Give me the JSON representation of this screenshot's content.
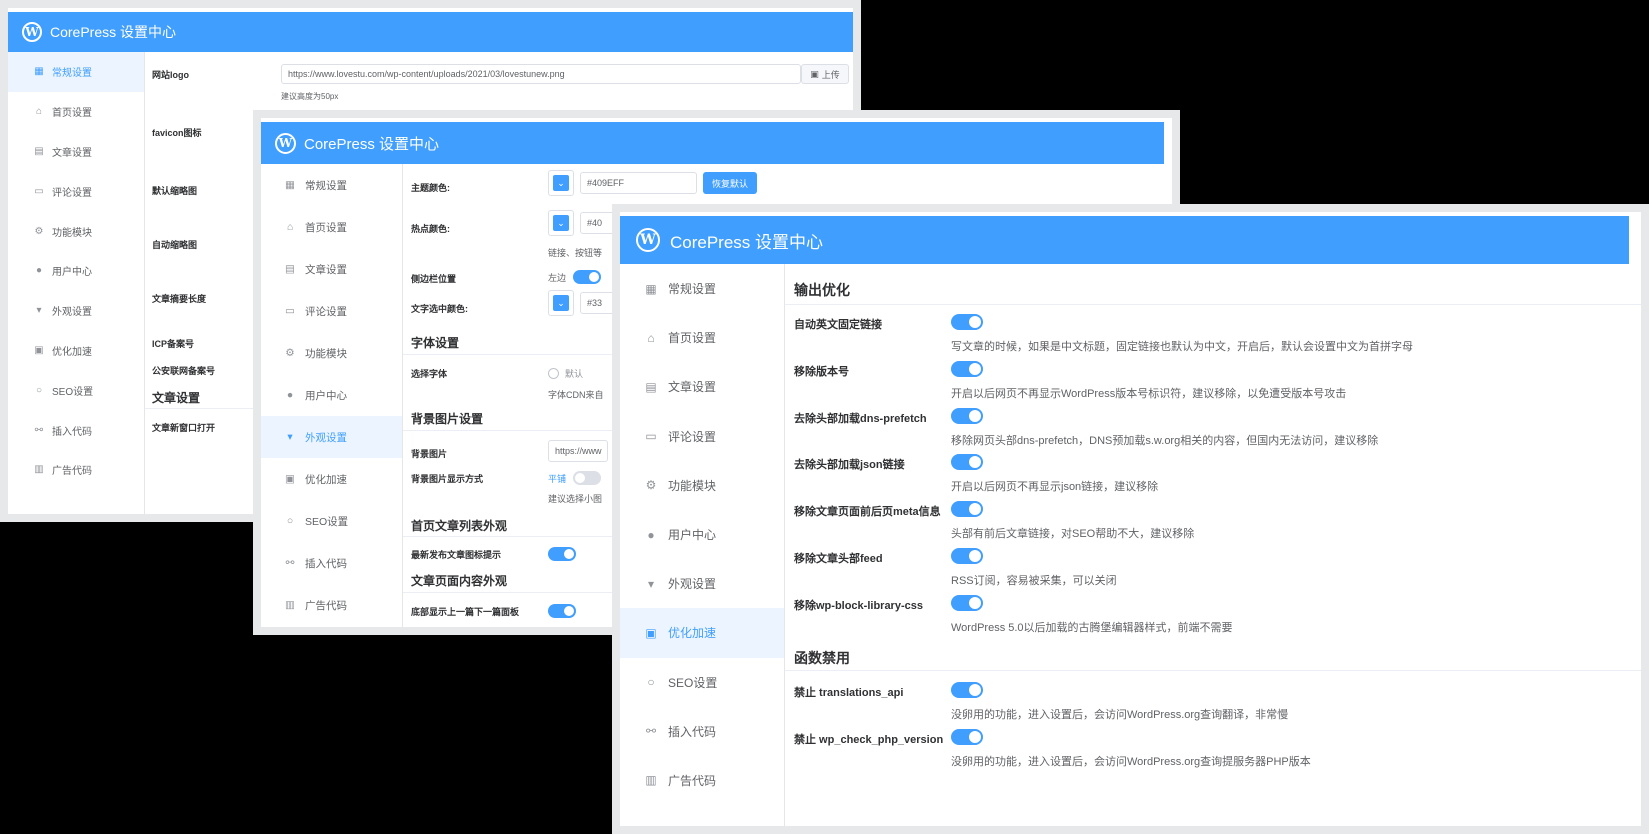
{
  "app_title": "CorePress 设置中心",
  "logo_letter": "W",
  "accent_color": "#409EFF",
  "nav": [
    {
      "label": "常规设置",
      "icon": "grid-icon",
      "glyph": "▦"
    },
    {
      "label": "首页设置",
      "icon": "home-icon",
      "glyph": "⌂"
    },
    {
      "label": "文章设置",
      "icon": "document-icon",
      "glyph": "▤"
    },
    {
      "label": "评论设置",
      "icon": "comment-icon",
      "glyph": "▭"
    },
    {
      "label": "功能模块",
      "icon": "gear-icon",
      "glyph": "⚙"
    },
    {
      "label": "用户中心",
      "icon": "user-icon",
      "glyph": "●"
    },
    {
      "label": "外观设置",
      "icon": "brush-icon",
      "glyph": "▾"
    },
    {
      "label": "优化加速",
      "icon": "chart-icon",
      "glyph": "▣"
    },
    {
      "label": "SEO设置",
      "icon": "search-icon",
      "glyph": "○"
    },
    {
      "label": "插入代码",
      "icon": "link-icon",
      "glyph": "⚯"
    },
    {
      "label": "广告代码",
      "icon": "ad-icon",
      "glyph": "▥"
    }
  ],
  "panel1": {
    "active_nav": 0,
    "logo_label": "网站logo",
    "logo_url": "https://www.lovestu.com/wp-content/uploads/2021/03/lovestunew.png",
    "upload_label": "上传",
    "logo_hint": "建议高度为50px",
    "labels": [
      "favicon图标",
      "默认缩略图",
      "自动缩略图",
      "文章摘要长度",
      "ICP备案号",
      "公安联网备案号"
    ],
    "section_article": "文章设置",
    "new_window_label": "文章新窗口打开"
  },
  "panel2": {
    "active_nav": 6,
    "theme_color_label": "主题颜色:",
    "theme_color_value": "#409EFF",
    "reset_label": "恢复默认",
    "hot_color_label": "热点颜色:",
    "hot_color_value": "#40",
    "hot_hint": "链接、按钮等",
    "sidebar_pos_label": "侧边栏位置",
    "sidebar_pos_value": "左边",
    "select_color_label": "文字选中颜色:",
    "select_color_value": "#33",
    "font_section": "字体设置",
    "font_label": "选择字体",
    "font_default": "默认",
    "font_hint": "字体CDN来自",
    "bg_section": "背景图片设置",
    "bg_label": "背景图片",
    "bg_value": "https://www",
    "bg_mode_label": "背景图片显示方式",
    "bg_mode_value": "平铺",
    "bg_hint": "建议选择小图",
    "home_list_section": "首页文章列表外观",
    "new_post_label": "最新发布文章图标提示",
    "article_section": "文章页面内容外观",
    "cut_label": "底部显示上一篇下一篇面板"
  },
  "panel3": {
    "active_nav": 7,
    "section_output": "输出优化",
    "output_items": [
      {
        "label": "自动英文固定链接",
        "desc": "写文章的时候，如果是中文标题，固定链接也默认为中文，开启后，默认会设置中文为首拼字母"
      },
      {
        "label": "移除版本号",
        "desc": "开启以后网页不再显示WordPress版本号标识符，建议移除，以免遭受版本号攻击"
      },
      {
        "label": "去除头部加载dns-prefetch",
        "desc": "移除网页头部dns-prefetch，DNS预加载s.w.org相关的内容，但国内无法访问，建议移除"
      },
      {
        "label": "去除头部加载json链接",
        "desc": "开启以后网页不再显示json链接，建议移除"
      },
      {
        "label": "移除文章页面前后页meta信息",
        "desc": "头部有前后文章链接，对SEO帮助不大，建议移除"
      },
      {
        "label": "移除文章头部feed",
        "desc": "RSS订阅，容易被采集，可以关闭"
      },
      {
        "label": "移除wp-block-library-css",
        "desc": "WordPress 5.0以后加载的古腾堡编辑器样式，前端不需要"
      }
    ],
    "section_func": "函数禁用",
    "func_items": [
      {
        "label": "禁止 translations_api",
        "desc": "没卵用的功能，进入设置后，会访问WordPress.org查询翻译，非常慢"
      },
      {
        "label": "禁止 wp_check_php_version",
        "desc": "没卵用的功能，进入设置后，会访问WordPress.org查询提服务器PHP版本"
      }
    ]
  }
}
